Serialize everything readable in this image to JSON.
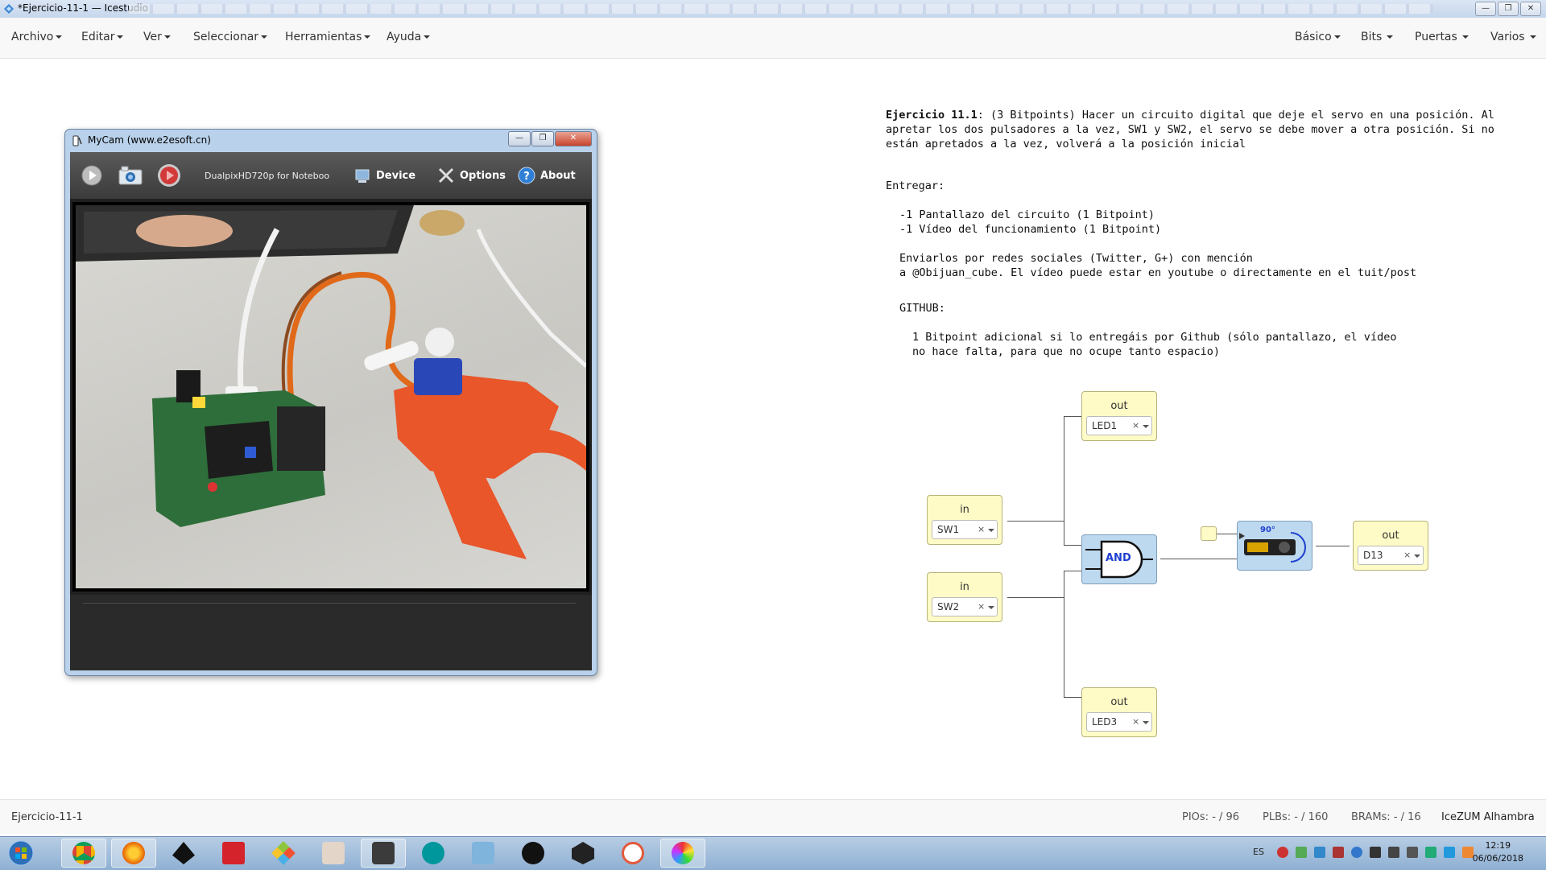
{
  "window": {
    "title": "*Ejercicio-11-1 — Icestudio",
    "buttons": [
      "—",
      "❐",
      "✕"
    ]
  },
  "menu": {
    "left": [
      "Archivo",
      "Editar",
      "Ver",
      "Seleccionar",
      "Herramientas",
      "Ayuda"
    ],
    "right": [
      "Básico",
      "Bits",
      "Puertas",
      "Varios"
    ]
  },
  "exercise": {
    "heading": "Ejercicio 11.1",
    "intro": ": (3 Bitpoints) Hacer un circuito digital que deje el servo en una posición. Al apretar los dos pulsadores a la vez, SW1 y SW2, el servo se debe mover a otra posición. Si no están apretados a la vez, volverá a la posición inicial",
    "deliver_label": "Entregar:",
    "deliver_items": [
      "-1 Pantallazo del circuito (1 Bitpoint)",
      "-1 Vídeo del funcionamiento (1 Bitpoint)"
    ],
    "social_1": "Enviarlos por redes sociales (Twitter, G+) con mención",
    "social_2": "a @Obijuan_cube. El vídeo puede estar en youtube o directamente en el tuit/post",
    "github_label": "GITHUB:",
    "github_1": "1 Bitpoint adicional si lo entregáis por Github (sólo pantallazo, el vídeo",
    "github_2": "no hace falta, para que no ocupe tanto espacio)"
  },
  "circuit": {
    "blocks": {
      "led1": {
        "title": "out",
        "pin": "LED1"
      },
      "sw1": {
        "title": "in",
        "pin": "SW1"
      },
      "sw2": {
        "title": "in",
        "pin": "SW2"
      },
      "d13": {
        "title": "out",
        "pin": "D13"
      },
      "led3": {
        "title": "out",
        "pin": "LED3"
      }
    },
    "clear_symbol": "×",
    "and_label": "AND",
    "servo_angle": "90°"
  },
  "mycam": {
    "title": "MyCam (www.e2esoft.cn)",
    "device_name": "DualpixHD720p for Noteboo",
    "device_label": "Device",
    "options_label": "Options",
    "about_label": "About"
  },
  "status": {
    "project": "Ejercicio-11-1",
    "pios": "PIOs:  - / 96",
    "plbs": "PLBs:  - / 160",
    "brams": "BRAMs:  - / 16",
    "board": "IceZUM Alhambra"
  },
  "taskbar": {
    "lang": "ES",
    "time": "12:19",
    "date": "06/06/2018",
    "apps": [
      "chrome-icon",
      "firefox-icon",
      "inkscape-icon",
      "freecad-icon",
      "git-icon",
      "wine-icon",
      "icestudio-icon",
      "arduino-icon",
      "box-icon",
      "processing-icon",
      "unity-icon",
      "app-a-icon",
      "color-icon"
    ]
  },
  "colors": {
    "io_block": "#fffbc6",
    "logic_block": "#bdd9ef",
    "taskbar": "#9fbcdc"
  }
}
